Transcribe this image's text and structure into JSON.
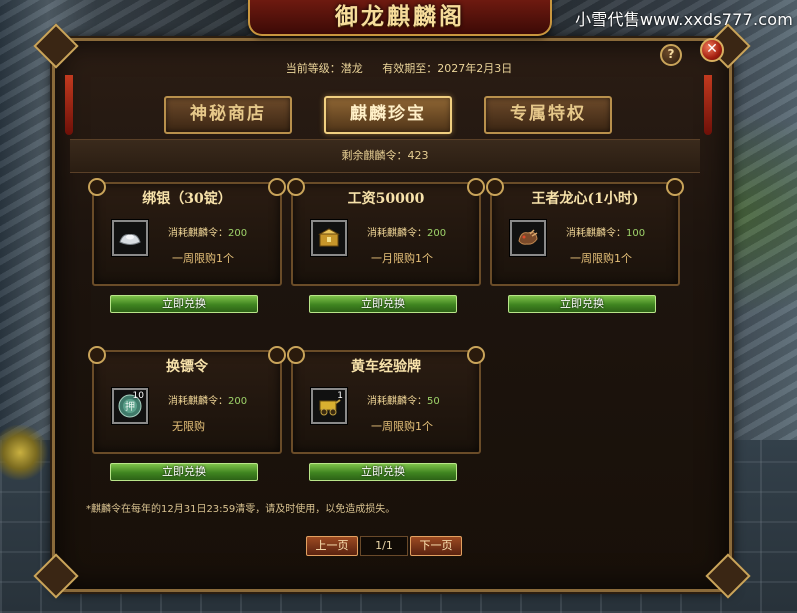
{
  "watermark": "小雪代售www.xxds777.com",
  "window": {
    "title": "御龙麒麟阁"
  },
  "info": {
    "level_label": "当前等级：潜龙",
    "expiry_label": "有效期至：2027年2月3日"
  },
  "tabs": [
    {
      "label": "神秘商店",
      "active": false
    },
    {
      "label": "麒麟珍宝",
      "active": true
    },
    {
      "label": "专属特权",
      "active": false
    }
  ],
  "remaining": "剩余麒麟令：423",
  "items": [
    {
      "title": "绑银（30锭）",
      "cost_label": "消耗麒麟令：",
      "cost": "200",
      "limit": "一周限购1个",
      "qty": "",
      "icon": "silver-ingot-icon",
      "button": "立即兑换"
    },
    {
      "title": "工资50000",
      "cost_label": "消耗麒麟令：",
      "cost": "200",
      "limit": "一月限购1个",
      "qty": "",
      "icon": "gold-box-icon",
      "button": "立即兑换"
    },
    {
      "title": "王者龙心(1小时)",
      "cost_label": "消耗麒麟令：",
      "cost": "100",
      "limit": "一周限购1个",
      "qty": "",
      "icon": "dragon-heart-icon",
      "button": "立即兑换"
    },
    {
      "title": "换镖令",
      "cost_label": "消耗麒麟令：",
      "cost": "200",
      "limit": "无限购",
      "qty": "10",
      "icon": "escort-token-icon",
      "button": "立即兑换"
    },
    {
      "title": "黄车经验牌",
      "cost_label": "消耗麒麟令：",
      "cost": "50",
      "limit": "一周限购1个",
      "qty": "1",
      "icon": "yellow-cart-exp-icon",
      "button": "立即兑换"
    }
  ],
  "note": "*麒麟令在每年的12月31日23:59清零，请及时使用，以免造成损失。",
  "pager": {
    "prev": "上一页",
    "page": "1/1",
    "next": "下一页"
  },
  "colors": {
    "accent_gold": "#c9a45a",
    "button_green": "#3f8420",
    "cost_green": "#9fd36a"
  }
}
